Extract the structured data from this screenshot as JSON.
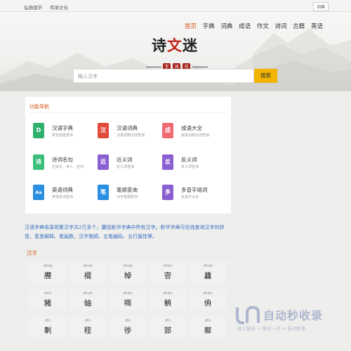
{
  "topbar": {
    "links": [
      "弘扬国学",
      "传承文化"
    ],
    "right_label": "词典"
  },
  "logo": {
    "main": "诗",
    "accent": "文",
    "tail": "迷",
    "seal": [
      "字",
      "词",
      "句"
    ]
  },
  "nav": {
    "items": [
      "首页",
      "字典",
      "词典",
      "成语",
      "作文",
      "诗词",
      "古籍",
      "英语"
    ],
    "active_index": 0
  },
  "search": {
    "placeholder": "输入汉字",
    "button": "搜索"
  },
  "function_nav": {
    "title": "功能导航",
    "items": [
      {
        "name": "汉语字典",
        "desc": "拼音部首查询",
        "icon": "dictionary-d-icon",
        "glyph": "D",
        "color": "#2fb16c"
      },
      {
        "name": "汉语词典",
        "desc": "汉语词典在线查询",
        "icon": "chinese-char-icon",
        "glyph": "汉",
        "color": "#e24b3b"
      },
      {
        "name": "成语大全",
        "desc": "成语词典在线查询",
        "icon": "idiom-icon",
        "glyph": "成",
        "color": "#ef6a72"
      },
      {
        "name": "诗词名句",
        "desc": "古诗文、诗人、名句",
        "icon": "poetry-icon",
        "glyph": "诗",
        "color": "#3cbf7a"
      },
      {
        "name": "近义词",
        "desc": "近义词查询",
        "icon": "synonym-icon",
        "glyph": "近",
        "color": "#8a5fd1"
      },
      {
        "name": "反义词",
        "desc": "反义词查询",
        "icon": "antonym-icon",
        "glyph": "反",
        "color": "#8a5fd1"
      },
      {
        "name": "英语词典",
        "desc": "英语单词查询",
        "icon": "english-dict-icon",
        "glyph": "Aa",
        "color": "#2a8fe0"
      },
      {
        "name": "笔顺查询",
        "desc": "汉字笔顺查询",
        "icon": "stroke-order-icon",
        "glyph": "笔",
        "color": "#2a8fe0"
      },
      {
        "name": "多音字组词",
        "desc": "多音字大全",
        "icon": "polyphone-icon",
        "glyph": "多",
        "color": "#8a5fd1"
      }
    ]
  },
  "intro": "汉语字典收录简繁汉字共2万多个，囊括新华字典中所有汉字。新华字典可在线查询汉字的拼音、意思解释、笔画数、汉字笔顺、五笔编码、五行属性等。",
  "chars_section": {
    "title": "汉字",
    "chars": [
      {
        "py": "zōng",
        "hz": "艭"
      },
      {
        "py": "zhuō",
        "hz": "棳"
      },
      {
        "py": "zhuō",
        "hz": "棹"
      },
      {
        "py": "chǒu",
        "hz": "㝓"
      },
      {
        "py": "zhuō",
        "hz": "蠿"
      },
      {
        "py": "zhū",
        "hz": "豬"
      },
      {
        "py": "zhuō",
        "hz": "蚰"
      },
      {
        "py": "zhōu",
        "hz": "啁"
      },
      {
        "py": "zhōu",
        "hz": "輈"
      },
      {
        "py": "zhōu",
        "hz": "侜"
      },
      {
        "py": "zhì",
        "hz": "剸"
      },
      {
        "py": "zhì",
        "hz": "秷"
      },
      {
        "py": "zhì",
        "hz": "徏"
      },
      {
        "py": "zhì",
        "hz": "郅"
      },
      {
        "py": "zhì",
        "hz": "穉"
      }
    ]
  },
  "watermark": {
    "title": "自动秒收录",
    "subtitle": "放上链接 → 来访一次 → 自动收录"
  },
  "colors": {
    "accent": "#d2541b",
    "search_button": "#f2b400",
    "link_blue": "#3a6fc4"
  }
}
